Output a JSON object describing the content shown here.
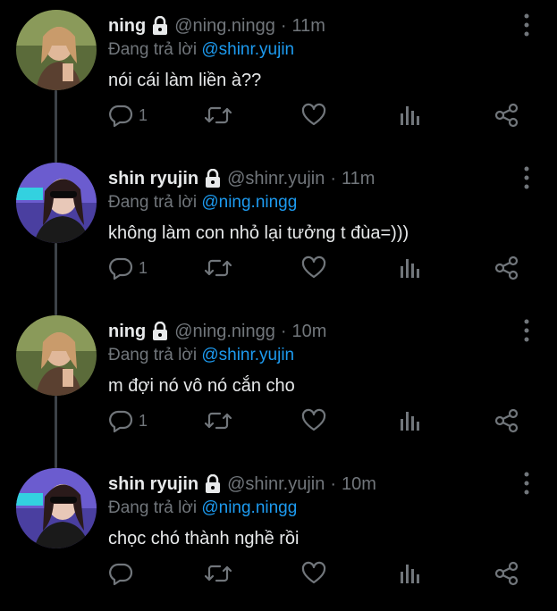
{
  "theme": {
    "background": "#000000",
    "text": "#e7e9ea",
    "secondary": "#71767b",
    "accent": "#1d9bf0",
    "thread_line": "#3d4248"
  },
  "icons": [
    "lock-icon",
    "more-icon",
    "reply-icon",
    "retweet-icon",
    "like-icon",
    "analytics-icon",
    "share-icon"
  ],
  "tweets": [
    {
      "name": "ning",
      "handle": "@ning.ningg",
      "separator": "·",
      "time": "11m",
      "replying_prefix": "Đang trả lời",
      "replying_to": "@shinr.yujin",
      "text": "nói cái làm liền à??",
      "reply_count": "1"
    },
    {
      "name": "shin ryujin",
      "handle": "@shinr.yujin",
      "separator": "·",
      "time": "11m",
      "replying_prefix": "Đang trả lời",
      "replying_to": "@ning.ningg",
      "text": "không làm con nhỏ lại tưởng t đùa=)))",
      "reply_count": "1"
    },
    {
      "name": "ning",
      "handle": "@ning.ningg",
      "separator": "·",
      "time": "10m",
      "replying_prefix": "Đang trả lời",
      "replying_to": "@shinr.yujin",
      "text": "m đợi nó vô nó cắn cho",
      "reply_count": "1"
    },
    {
      "name": "shin ryujin",
      "handle": "@shinr.yujin",
      "separator": "·",
      "time": "10m",
      "replying_prefix": "Đang trả lời",
      "replying_to": "@ning.ningg",
      "text": "chọc chó thành nghề rồi",
      "reply_count": ""
    }
  ]
}
